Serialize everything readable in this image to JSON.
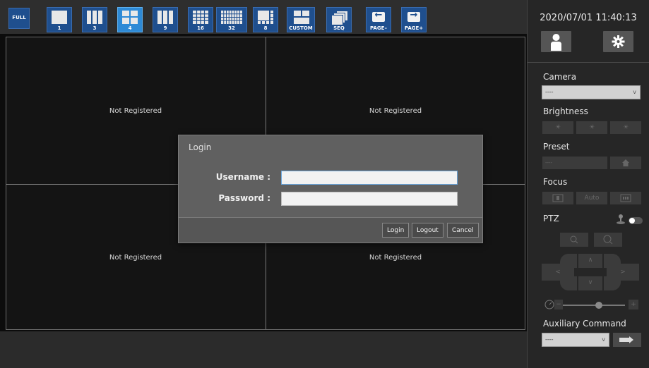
{
  "toolbar": {
    "full_label": "FULL",
    "layouts": [
      {
        "label": "1"
      },
      {
        "label": "3"
      },
      {
        "label": "4",
        "active": true
      },
      {
        "label": "9"
      },
      {
        "label": "16"
      },
      {
        "label": "32"
      },
      {
        "label": "8"
      },
      {
        "label": "CUSTOM"
      }
    ],
    "seq_label": "SEQ",
    "page_prev_label": "PAGE–",
    "page_next_label": "PAGE+",
    "page_prev_glyph": "←",
    "page_next_glyph": "→"
  },
  "grid": {
    "cells": [
      {
        "status": "Not Registered"
      },
      {
        "status": "Not Registered"
      },
      {
        "status": "Not Registered"
      },
      {
        "status": "Not Registered"
      }
    ]
  },
  "panel": {
    "datetime": "2020/07/01 11:40:13",
    "camera_label": "Camera",
    "camera_value": "----",
    "select_chevron": "v",
    "brightness_label": "Brightness",
    "brightness_glyph": "☀",
    "preset_label": "Preset",
    "preset_value": "----",
    "focus_label": "Focus",
    "focus_auto_label": "Auto",
    "ptz_label": "PTZ",
    "ptz_up_glyph": "∧",
    "ptz_down_glyph": "∨",
    "ptz_left_glyph": "<",
    "ptz_right_glyph": ">",
    "zoom_minus_glyph": "−",
    "zoom_plus_glyph": "+",
    "aux_label": "Auxiliary Command",
    "aux_value": "----"
  },
  "login": {
    "title": "Login",
    "username_label": "Username :",
    "password_label": "Password :",
    "username_value": "",
    "password_value": "",
    "login_button": "Login",
    "logout_button": "Logout",
    "cancel_button": "Cancel"
  },
  "colors": {
    "button_blue": "#1f4f8e",
    "button_active": "#2e8ad6",
    "panel_bg": "#262626"
  }
}
